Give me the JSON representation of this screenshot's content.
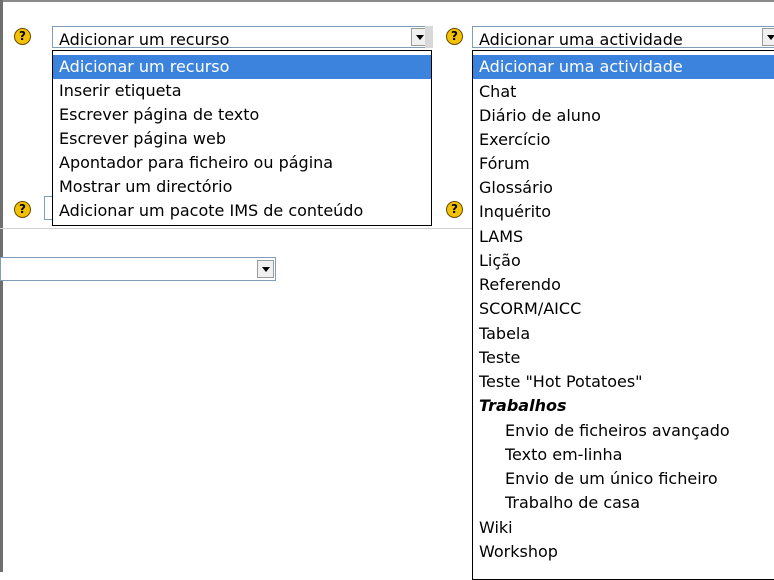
{
  "left_select": {
    "selected": "Adicionar um recurso",
    "options": [
      "Adicionar um recurso",
      "Inserir etiqueta",
      "Escrever página de texto",
      "Escrever página web",
      "Apontador para ficheiro ou página",
      "Mostrar um directório",
      "Adicionar um pacote IMS de conteúdo"
    ]
  },
  "right_select": {
    "selected": "Adicionar uma actividade",
    "options": [
      "Adicionar uma actividade",
      "Chat",
      "Diário de aluno",
      "Exercício",
      "Fórum",
      "Glossário",
      "Inquérito",
      "LAMS",
      "Lição",
      "Referendo",
      "SCORM/AICC",
      "Tabela",
      "Teste",
      "Teste \"Hot Potatoes\"",
      "Trabalhos",
      "Envio de ficheiros avançado",
      "Texto em-linha",
      "Envio de um único ficheiro",
      "Trabalho de casa",
      "Wiki",
      "Workshop"
    ]
  },
  "help_icon": "?",
  "colors": {
    "highlight": "#3b83dc",
    "help_icon": "#f2c200"
  }
}
